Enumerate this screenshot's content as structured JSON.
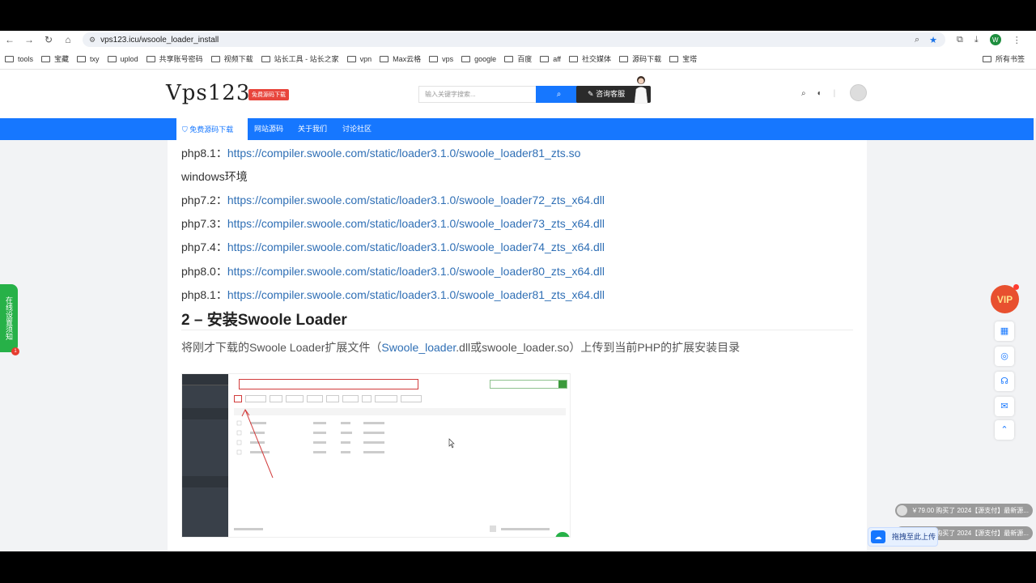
{
  "browser": {
    "url": "vps123.icu/wsoole_loader_install",
    "profile_initial": "W",
    "bookmarks": [
      "tools",
      "宝藏",
      "txy",
      "uplod",
      "共享账号密码",
      "视频下载",
      "站长工具 - 站长之家",
      "vpn",
      "Max云格",
      "vps",
      "google",
      "百度",
      "aff",
      "社交媒体",
      "源码下载",
      "宝塔"
    ],
    "all_bookmarks_label": "所有书签"
  },
  "header": {
    "logo": "Vps123",
    "logo_badge": "免费源码下载",
    "search_placeholder": "输入关键字搜索...",
    "consult_label": "咨询客服"
  },
  "nav": {
    "items": [
      "免费源码下载",
      "网站源码",
      "关于我们",
      "讨论社区"
    ]
  },
  "article": {
    "lines": [
      {
        "label": "php8.1：",
        "link": "https://compiler.swoole.com/static/loader3.1.0/swoole_loader81_zts.so"
      },
      {
        "label": "windows环境",
        "link": ""
      },
      {
        "label": "php7.2：",
        "link": "https://compiler.swoole.com/static/loader3.1.0/swoole_loader72_zts_x64.dll"
      },
      {
        "label": "php7.3：",
        "link": "https://compiler.swoole.com/static/loader3.1.0/swoole_loader73_zts_x64.dll"
      },
      {
        "label": "php7.4：",
        "link": "https://compiler.swoole.com/static/loader3.1.0/swoole_loader74_zts_x64.dll"
      },
      {
        "label": "php8.0：",
        "link": "https://compiler.swoole.com/static/loader3.1.0/swoole_loader80_zts_x64.dll"
      },
      {
        "label": "php8.1：",
        "link": "https://compiler.swoole.com/static/loader3.1.0/swoole_loader81_zts_x64.dll"
      }
    ],
    "heading": "2 – 安装Swoole Loader",
    "para_before": "将刚才下载的Swoole Loader扩展文件（",
    "para_link": "Swoole_loader",
    "para_after": ".dll或swoole_loader.so）上传到当前PHP的扩展安装目录"
  },
  "widgets": {
    "left_tag": "在线设置须知",
    "left_badge": "1",
    "vip": "VIP",
    "toasts": [
      "￥79.00 购买了 2024【源支付】最新源...",
      "￥79.00 购买了 2024【源支付】最新源..."
    ],
    "upload_label": "拖拽至此上传"
  }
}
